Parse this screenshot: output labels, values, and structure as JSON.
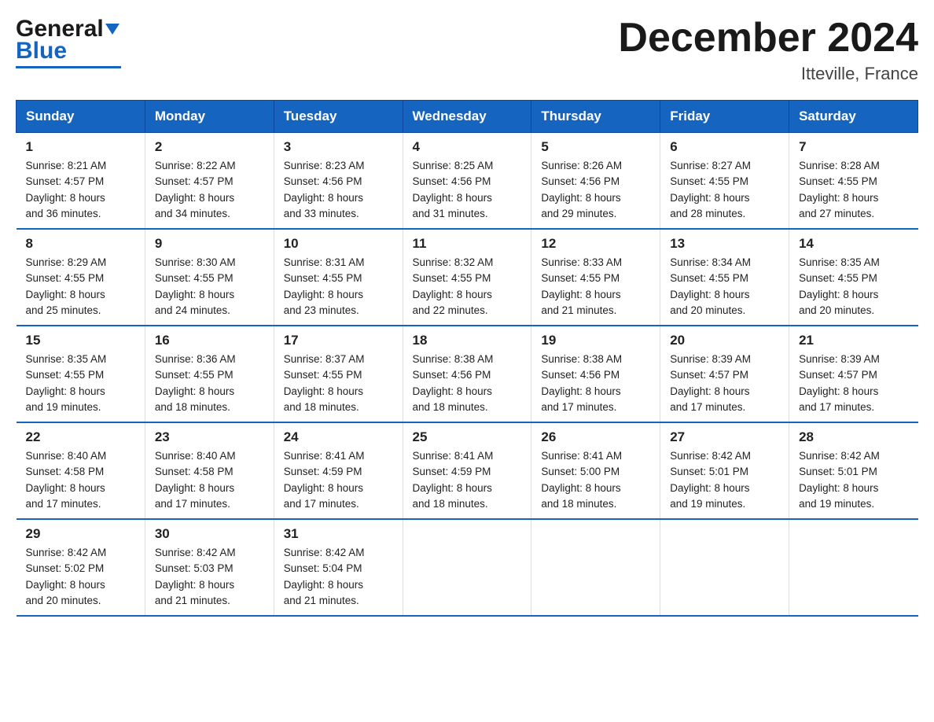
{
  "header": {
    "logo_general": "General",
    "logo_blue": "Blue",
    "month_title": "December 2024",
    "location": "Itteville, France"
  },
  "days_of_week": [
    "Sunday",
    "Monday",
    "Tuesday",
    "Wednesday",
    "Thursday",
    "Friday",
    "Saturday"
  ],
  "weeks": [
    [
      {
        "day": "1",
        "info": "Sunrise: 8:21 AM\nSunset: 4:57 PM\nDaylight: 8 hours\nand 36 minutes."
      },
      {
        "day": "2",
        "info": "Sunrise: 8:22 AM\nSunset: 4:57 PM\nDaylight: 8 hours\nand 34 minutes."
      },
      {
        "day": "3",
        "info": "Sunrise: 8:23 AM\nSunset: 4:56 PM\nDaylight: 8 hours\nand 33 minutes."
      },
      {
        "day": "4",
        "info": "Sunrise: 8:25 AM\nSunset: 4:56 PM\nDaylight: 8 hours\nand 31 minutes."
      },
      {
        "day": "5",
        "info": "Sunrise: 8:26 AM\nSunset: 4:56 PM\nDaylight: 8 hours\nand 29 minutes."
      },
      {
        "day": "6",
        "info": "Sunrise: 8:27 AM\nSunset: 4:55 PM\nDaylight: 8 hours\nand 28 minutes."
      },
      {
        "day": "7",
        "info": "Sunrise: 8:28 AM\nSunset: 4:55 PM\nDaylight: 8 hours\nand 27 minutes."
      }
    ],
    [
      {
        "day": "8",
        "info": "Sunrise: 8:29 AM\nSunset: 4:55 PM\nDaylight: 8 hours\nand 25 minutes."
      },
      {
        "day": "9",
        "info": "Sunrise: 8:30 AM\nSunset: 4:55 PM\nDaylight: 8 hours\nand 24 minutes."
      },
      {
        "day": "10",
        "info": "Sunrise: 8:31 AM\nSunset: 4:55 PM\nDaylight: 8 hours\nand 23 minutes."
      },
      {
        "day": "11",
        "info": "Sunrise: 8:32 AM\nSunset: 4:55 PM\nDaylight: 8 hours\nand 22 minutes."
      },
      {
        "day": "12",
        "info": "Sunrise: 8:33 AM\nSunset: 4:55 PM\nDaylight: 8 hours\nand 21 minutes."
      },
      {
        "day": "13",
        "info": "Sunrise: 8:34 AM\nSunset: 4:55 PM\nDaylight: 8 hours\nand 20 minutes."
      },
      {
        "day": "14",
        "info": "Sunrise: 8:35 AM\nSunset: 4:55 PM\nDaylight: 8 hours\nand 20 minutes."
      }
    ],
    [
      {
        "day": "15",
        "info": "Sunrise: 8:35 AM\nSunset: 4:55 PM\nDaylight: 8 hours\nand 19 minutes."
      },
      {
        "day": "16",
        "info": "Sunrise: 8:36 AM\nSunset: 4:55 PM\nDaylight: 8 hours\nand 18 minutes."
      },
      {
        "day": "17",
        "info": "Sunrise: 8:37 AM\nSunset: 4:55 PM\nDaylight: 8 hours\nand 18 minutes."
      },
      {
        "day": "18",
        "info": "Sunrise: 8:38 AM\nSunset: 4:56 PM\nDaylight: 8 hours\nand 18 minutes."
      },
      {
        "day": "19",
        "info": "Sunrise: 8:38 AM\nSunset: 4:56 PM\nDaylight: 8 hours\nand 17 minutes."
      },
      {
        "day": "20",
        "info": "Sunrise: 8:39 AM\nSunset: 4:57 PM\nDaylight: 8 hours\nand 17 minutes."
      },
      {
        "day": "21",
        "info": "Sunrise: 8:39 AM\nSunset: 4:57 PM\nDaylight: 8 hours\nand 17 minutes."
      }
    ],
    [
      {
        "day": "22",
        "info": "Sunrise: 8:40 AM\nSunset: 4:58 PM\nDaylight: 8 hours\nand 17 minutes."
      },
      {
        "day": "23",
        "info": "Sunrise: 8:40 AM\nSunset: 4:58 PM\nDaylight: 8 hours\nand 17 minutes."
      },
      {
        "day": "24",
        "info": "Sunrise: 8:41 AM\nSunset: 4:59 PM\nDaylight: 8 hours\nand 17 minutes."
      },
      {
        "day": "25",
        "info": "Sunrise: 8:41 AM\nSunset: 4:59 PM\nDaylight: 8 hours\nand 18 minutes."
      },
      {
        "day": "26",
        "info": "Sunrise: 8:41 AM\nSunset: 5:00 PM\nDaylight: 8 hours\nand 18 minutes."
      },
      {
        "day": "27",
        "info": "Sunrise: 8:42 AM\nSunset: 5:01 PM\nDaylight: 8 hours\nand 19 minutes."
      },
      {
        "day": "28",
        "info": "Sunrise: 8:42 AM\nSunset: 5:01 PM\nDaylight: 8 hours\nand 19 minutes."
      }
    ],
    [
      {
        "day": "29",
        "info": "Sunrise: 8:42 AM\nSunset: 5:02 PM\nDaylight: 8 hours\nand 20 minutes."
      },
      {
        "day": "30",
        "info": "Sunrise: 8:42 AM\nSunset: 5:03 PM\nDaylight: 8 hours\nand 21 minutes."
      },
      {
        "day": "31",
        "info": "Sunrise: 8:42 AM\nSunset: 5:04 PM\nDaylight: 8 hours\nand 21 minutes."
      },
      {
        "day": "",
        "info": ""
      },
      {
        "day": "",
        "info": ""
      },
      {
        "day": "",
        "info": ""
      },
      {
        "day": "",
        "info": ""
      }
    ]
  ]
}
